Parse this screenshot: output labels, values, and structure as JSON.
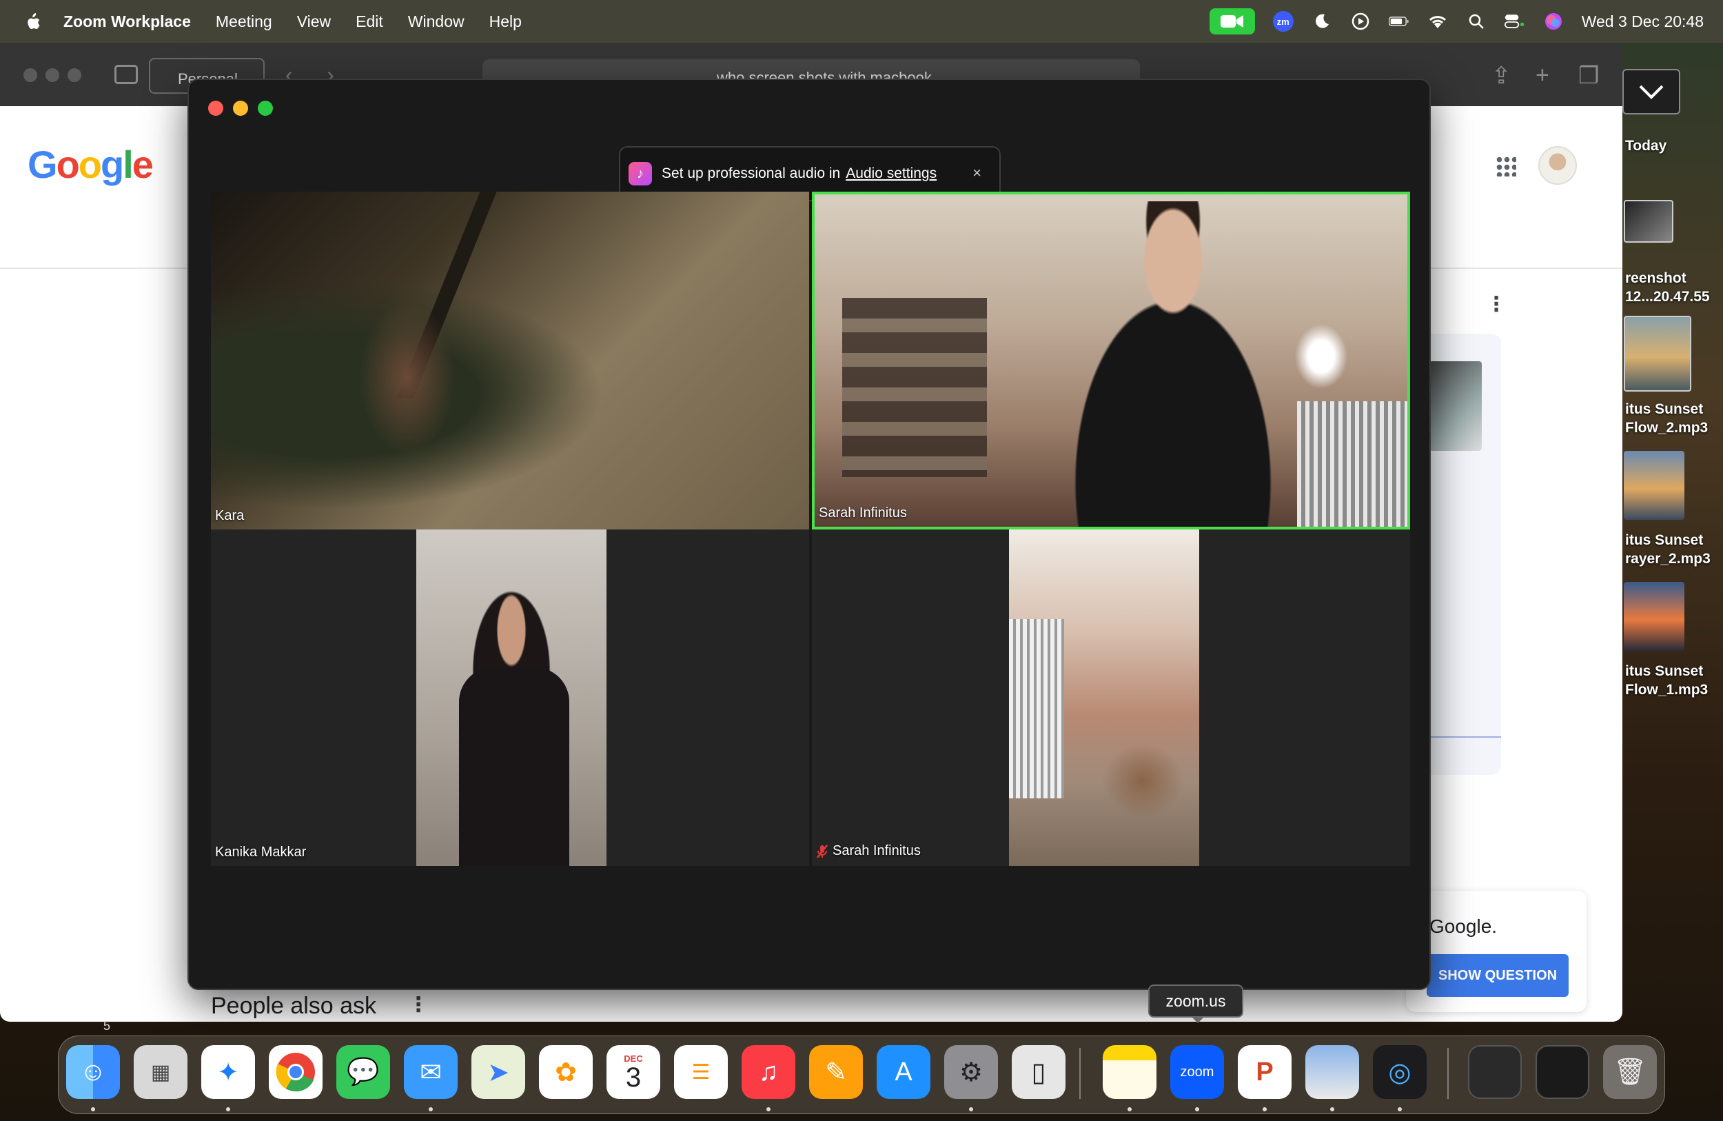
{
  "menubar": {
    "app_name": "Zoom Workplace",
    "menus": [
      "Meeting",
      "View",
      "Edit",
      "Window",
      "Help"
    ],
    "zm_label": "zm",
    "datetime": "Wed 3 Dec  20:48"
  },
  "browser": {
    "profile": "Personal",
    "url": "who screen shots with macbook",
    "google_logo": [
      "G",
      "o",
      "o",
      "g",
      "l",
      "e"
    ],
    "card_fragment": "Google.",
    "show_question": "SHOW QUESTION",
    "people_also_ask": "People also ask",
    "page_number": "5"
  },
  "desktop": {
    "stack_label": "Today",
    "files": [
      {
        "line1": "reenshot",
        "line2": "12...20.47.55"
      },
      {
        "line1": "itus Sunset",
        "line2": "Flow_2.mp3"
      },
      {
        "line1": "itus Sunset",
        "line2": "rayer_2.mp3"
      },
      {
        "line1": "itus Sunset",
        "line2": "Flow_1.mp3"
      }
    ]
  },
  "zoom": {
    "toast_text": "Set up professional audio in",
    "toast_link": "Audio settings",
    "toast_close": "×",
    "participants": [
      {
        "name": "Kara"
      },
      {
        "name": "Sarah Infinitus"
      },
      {
        "name": "Kanika Makkar"
      },
      {
        "name": "Sarah Infinitus",
        "muted": true
      }
    ]
  },
  "dock": {
    "tooltip": "zoom.us",
    "calendar_month": "DEC",
    "calendar_day": "3",
    "zoom_label": "zoom",
    "ppt_label": "P"
  },
  "colors": {
    "zoom_green_status": "#2ecc40",
    "active_speaker_border": "#4be04b",
    "zoom_blue": "#0b5cff",
    "google_button": "#3b78e7"
  }
}
